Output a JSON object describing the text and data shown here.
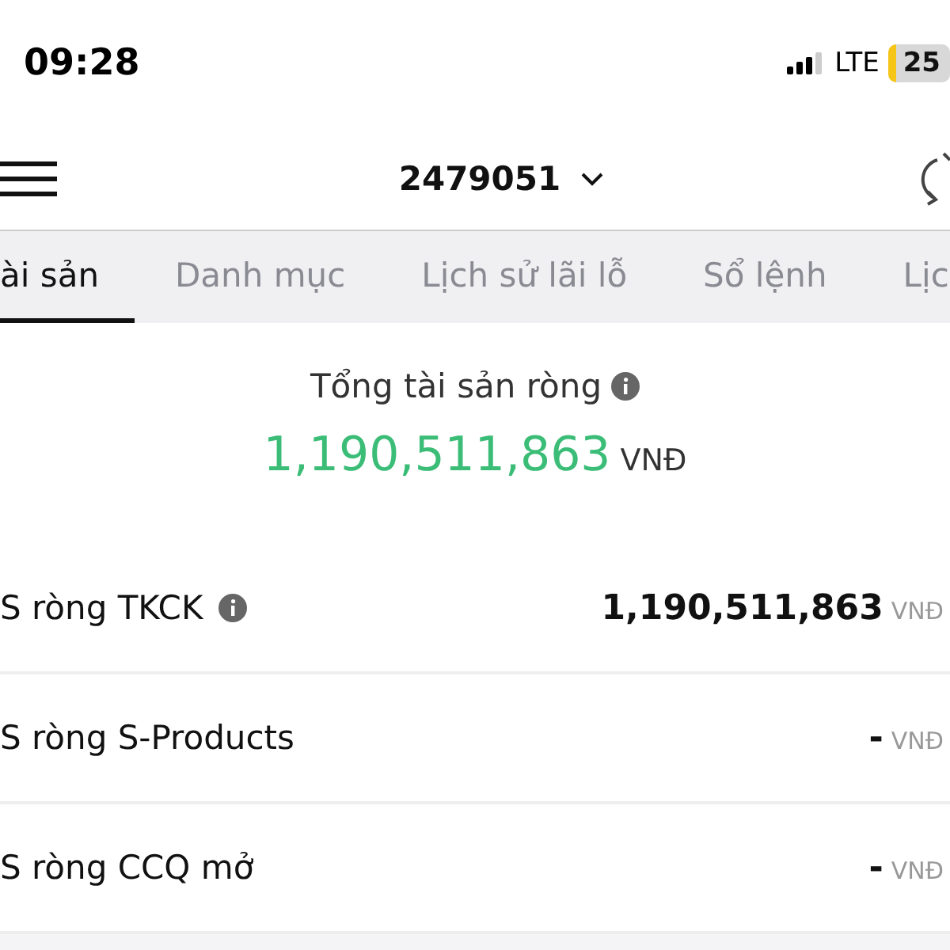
{
  "status_bar": {
    "time": "09:28",
    "network": "LTE",
    "battery": "25"
  },
  "header": {
    "account": "2479051"
  },
  "tabs": [
    {
      "label": "ài sản",
      "selected": true
    },
    {
      "label": "Danh mục",
      "selected": false
    },
    {
      "label": "Lịch sử lãi lỗ",
      "selected": false
    },
    {
      "label": "Sổ lệnh",
      "selected": false
    },
    {
      "label": "Lịc",
      "selected": false
    }
  ],
  "summary": {
    "title": "Tổng tài sản ròng",
    "amount": "1,190,511,863",
    "currency": "VNĐ"
  },
  "rows": [
    {
      "label": "S ròng TKCK",
      "info": true,
      "value": "1,190,511,863",
      "currency": "VNĐ"
    },
    {
      "label": "S ròng S-Products",
      "info": false,
      "value": "-",
      "currency": "VNĐ"
    },
    {
      "label": "S ròng CCQ mở",
      "info": false,
      "value": "-",
      "currency": "VNĐ"
    }
  ]
}
